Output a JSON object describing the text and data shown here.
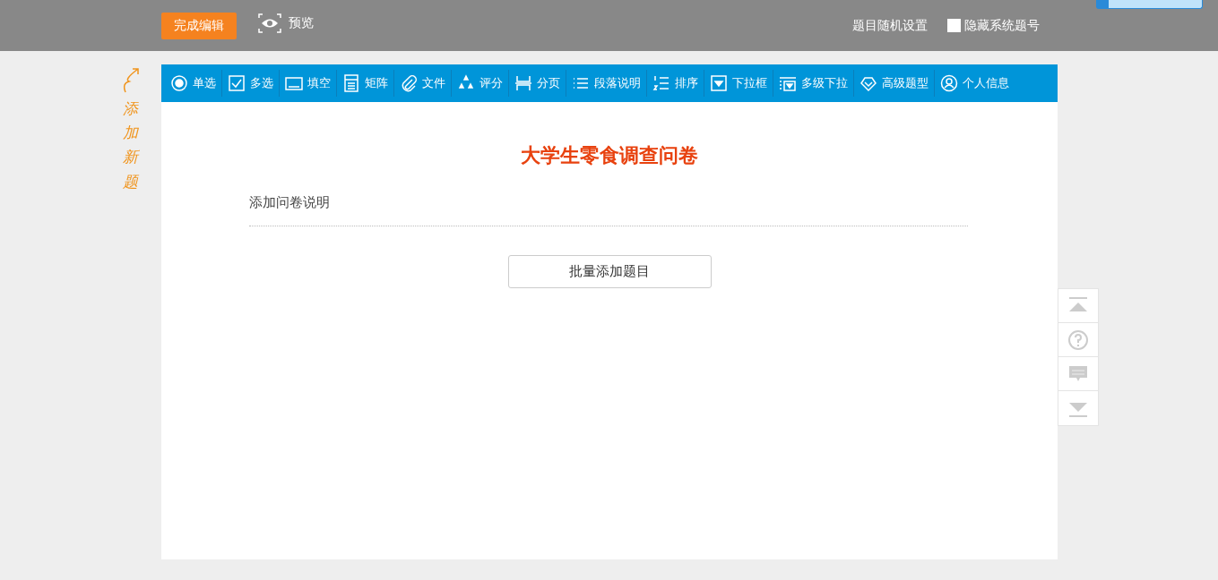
{
  "top_bar": {
    "finish_button": "完成编辑",
    "preview_link": "预览",
    "random_setting": "题目随机设置",
    "hide_numbers": {
      "label": "隐藏系统题号",
      "checked": false
    }
  },
  "hint": "添加新题",
  "question_types": [
    {
      "label": "单选",
      "kind": "radio"
    },
    {
      "label": "多选",
      "kind": "checkbox"
    },
    {
      "label": "填空",
      "kind": "blank"
    },
    {
      "label": "矩阵",
      "kind": "matrix"
    },
    {
      "label": "文件",
      "kind": "file"
    },
    {
      "label": "评分",
      "kind": "rating"
    },
    {
      "label": "分页",
      "kind": "page"
    },
    {
      "label": "段落说明",
      "kind": "paragraph"
    },
    {
      "label": "排序",
      "kind": "sort"
    },
    {
      "label": "下拉框",
      "kind": "dropdown"
    },
    {
      "label": "多级下拉",
      "kind": "multidropdown"
    },
    {
      "label": "高级题型",
      "kind": "advanced"
    },
    {
      "label": "个人信息",
      "kind": "person"
    }
  ],
  "survey": {
    "title": "大学生零食调查问卷",
    "description": "添加问卷说明",
    "batch_button": "批量添加题目"
  },
  "side_tools": [
    {
      "kind": "top"
    },
    {
      "kind": "help"
    },
    {
      "kind": "comment"
    },
    {
      "kind": "bottom"
    }
  ]
}
